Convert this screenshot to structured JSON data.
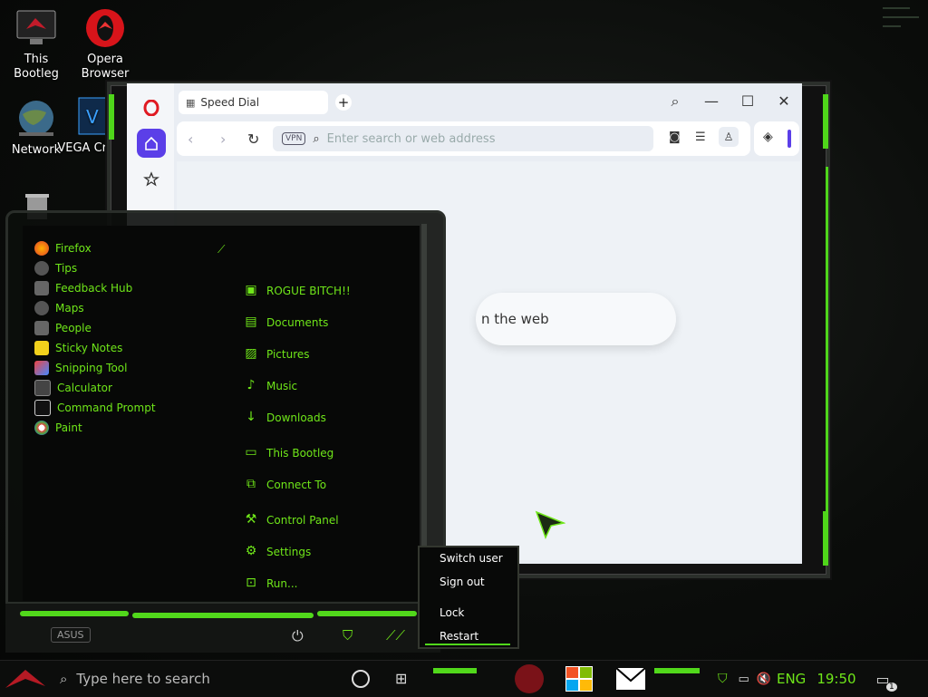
{
  "desktop": {
    "icons": [
      {
        "label": "This Bootleg"
      },
      {
        "label": "Opera Browser"
      },
      {
        "label": "Network"
      },
      {
        "label": "VEGA Crack"
      }
    ]
  },
  "browser": {
    "tab_title": "Speed Dial",
    "vpn_badge": "VPN",
    "address_placeholder": "Enter search or web address",
    "search_hint": "n the web",
    "accent": "#5b3fe8"
  },
  "start_menu": {
    "apps": [
      {
        "label": "Firefox",
        "icon": "firefox-icon"
      },
      {
        "label": "Tips",
        "icon": "lightbulb-icon"
      },
      {
        "label": "Feedback Hub",
        "icon": "feedback-icon"
      },
      {
        "label": "Maps",
        "icon": "maps-icon"
      },
      {
        "label": "People",
        "icon": "people-icon"
      },
      {
        "label": "Sticky Notes",
        "icon": "sticky-notes-icon"
      },
      {
        "label": "Snipping Tool",
        "icon": "scissors-icon"
      },
      {
        "label": "Calculator",
        "icon": "calculator-icon"
      },
      {
        "label": "Command Prompt",
        "icon": "terminal-icon"
      },
      {
        "label": "Paint",
        "icon": "palette-icon"
      }
    ],
    "places": [
      {
        "label": "ROGUE BITCH!!",
        "icon": "user-icon"
      },
      {
        "label": "Documents",
        "icon": "document-icon"
      },
      {
        "label": "Pictures",
        "icon": "picture-icon"
      },
      {
        "label": "Music",
        "icon": "music-icon"
      },
      {
        "label": "Downloads",
        "icon": "download-icon"
      },
      {
        "label": "This Bootleg",
        "icon": "computer-icon"
      },
      {
        "label": "Connect To",
        "icon": "network-icon"
      },
      {
        "label": "Control Panel",
        "icon": "wrench-icon"
      },
      {
        "label": "Settings",
        "icon": "gear-icon"
      },
      {
        "label": "Run...",
        "icon": "run-icon"
      }
    ],
    "accent": "#6fe619",
    "base_logo": "ASUS"
  },
  "power_menu": {
    "items": [
      "Switch user",
      "Sign out",
      "Lock",
      "Restart"
    ]
  },
  "taskbar": {
    "search_placeholder": "Type here to search",
    "language": "ENG",
    "time": "19:50",
    "notification_count": "1"
  }
}
